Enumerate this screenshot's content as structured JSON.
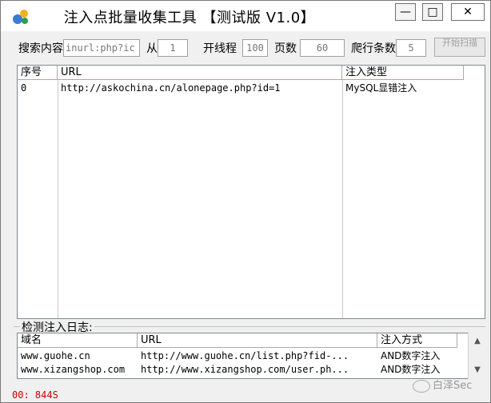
{
  "window": {
    "title": "注入点批量收集工具 【测试版 V1.0】"
  },
  "controls": {
    "minimize": "—",
    "maximize": "□",
    "close": "✕"
  },
  "search": {
    "label": "搜索内容",
    "value": "inurl:php?ic",
    "from_label": "从",
    "from_value": "1",
    "threads_label": "开线程",
    "threads_value": "100",
    "pages_label": "页数",
    "pages_value": "60",
    "crawl_label": "爬行条数",
    "crawl_value": "5",
    "start_button": "开始扫描"
  },
  "results": {
    "columns": [
      "序号",
      "URL",
      "注入类型"
    ],
    "rows": [
      {
        "index": "0",
        "url": "http://askochina.cn/alonepage.php?id=1",
        "type": "MySQL显错注入"
      }
    ]
  },
  "log": {
    "title": "检测注入日志:",
    "columns": [
      "域名",
      "URL",
      "注入方式"
    ],
    "rows": [
      {
        "domain": "www.guohe.cn",
        "url": "http://www.guohe.cn/list.php?fid-...",
        "method": "AND数字注入"
      },
      {
        "domain": "www.xizangshop.com",
        "url": "http://www.xizangshop.com/user.ph...",
        "method": "AND数字注入"
      }
    ]
  },
  "status": {
    "text": "00: 844S"
  },
  "watermark": {
    "text": "白泽Sec"
  }
}
